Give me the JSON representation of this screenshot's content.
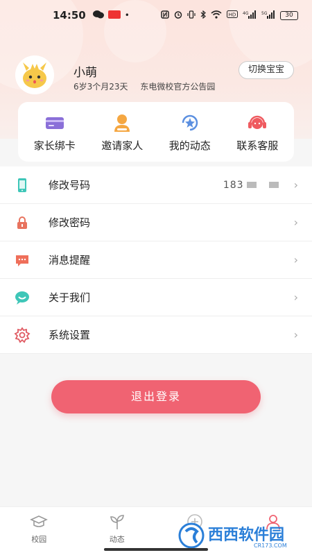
{
  "status_bar": {
    "time": "14:50",
    "battery": "30",
    "network": "4G",
    "network2": "5G"
  },
  "profile": {
    "name": "小萌",
    "age": "6岁3个月23天",
    "school": "东电微校官方公告园",
    "switch_label": "切换宝宝"
  },
  "quick_actions": [
    {
      "label": "家长绑卡",
      "icon": "card-icon",
      "color": "#8a6fd8"
    },
    {
      "label": "邀请家人",
      "icon": "person-icon",
      "color": "#f5a742"
    },
    {
      "label": "我的动态",
      "icon": "star-refresh-icon",
      "color": "#5b8fe0"
    },
    {
      "label": "联系客服",
      "icon": "headset-icon",
      "color": "#ef5b60"
    }
  ],
  "menu": [
    {
      "label": "修改号码",
      "value": "183",
      "icon": "phone-icon"
    },
    {
      "label": "修改密码",
      "icon": "lock-icon"
    },
    {
      "label": "消息提醒",
      "icon": "message-icon"
    },
    {
      "label": "关于我们",
      "icon": "chat-bubble-icon"
    },
    {
      "label": "系统设置",
      "icon": "gear-icon"
    }
  ],
  "logout_label": "退出登录",
  "tabs": [
    {
      "label": "校园",
      "icon": "graduation-cap-icon"
    },
    {
      "label": "动态",
      "icon": "sprout-icon"
    },
    {
      "label": "",
      "icon": "publish-icon"
    },
    {
      "label": "",
      "icon": "profile-icon"
    }
  ],
  "watermark": {
    "text": "西西软件园",
    "sub": "CR173.COM"
  },
  "colors": {
    "accent": "#f06372",
    "header_bg": "#fce4de"
  }
}
